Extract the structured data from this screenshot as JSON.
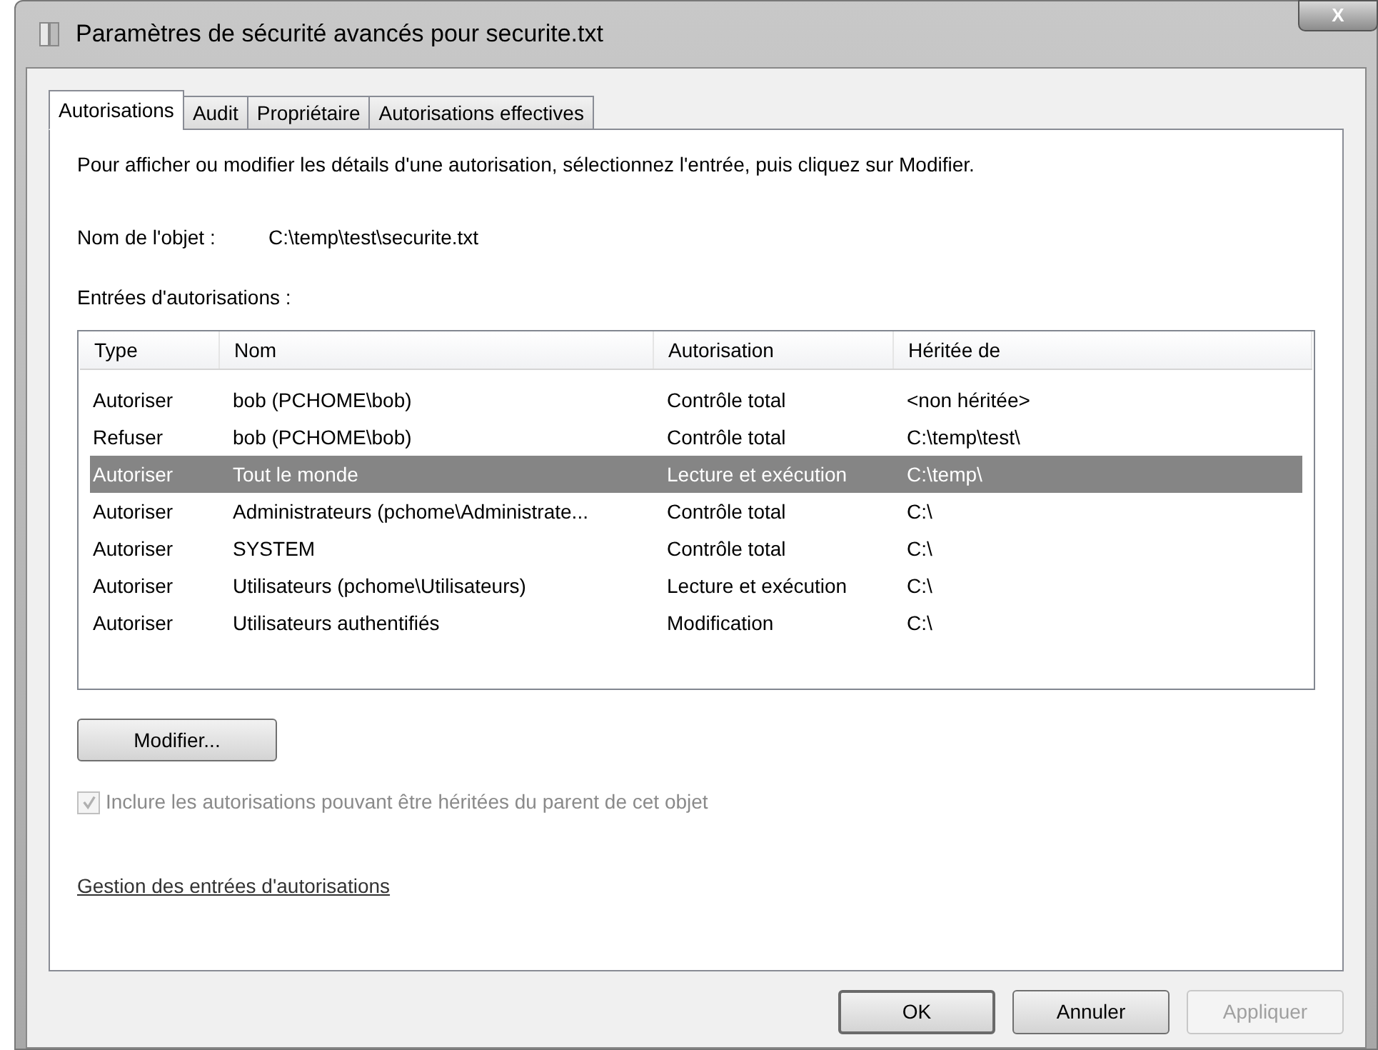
{
  "window": {
    "title": "Paramètres de sécurité avancés pour securite.txt",
    "close": "X"
  },
  "tabs": [
    {
      "label": "Autorisations",
      "selected": true
    },
    {
      "label": "Audit",
      "selected": false
    },
    {
      "label": "Propriétaire",
      "selected": false
    },
    {
      "label": "Autorisations effectives",
      "selected": false
    }
  ],
  "instructions": "Pour afficher ou modifier les détails d'une autorisation, sélectionnez l'entrée, puis cliquez sur Modifier.",
  "object_name": {
    "label": "Nom de l'objet :",
    "value": "C:\\temp\\test\\securite.txt"
  },
  "entries_label": "Entrées d'autorisations :",
  "table": {
    "columns": [
      "Type",
      "Nom",
      "Autorisation",
      "Héritée de"
    ],
    "rows": [
      {
        "cells": [
          "Autoriser",
          "bob (PCHOME\\bob)",
          "Contrôle total",
          "<non héritée>"
        ],
        "selected": false
      },
      {
        "cells": [
          "Refuser",
          "bob (PCHOME\\bob)",
          "Contrôle total",
          "C:\\temp\\test\\"
        ],
        "selected": false
      },
      {
        "cells": [
          "Autoriser",
          "Tout le monde",
          "Lecture et exécution",
          "C:\\temp\\"
        ],
        "selected": true
      },
      {
        "cells": [
          "Autoriser",
          "Administrateurs (pchome\\Administrate...",
          "Contrôle total",
          "C:\\"
        ],
        "selected": false
      },
      {
        "cells": [
          "Autoriser",
          "SYSTEM",
          "Contrôle total",
          "C:\\"
        ],
        "selected": false
      },
      {
        "cells": [
          "Autoriser",
          "Utilisateurs (pchome\\Utilisateurs)",
          "Lecture et exécution",
          "C:\\"
        ],
        "selected": false
      },
      {
        "cells": [
          "Autoriser",
          "Utilisateurs authentifiés",
          "Modification",
          "C:\\"
        ],
        "selected": false
      }
    ]
  },
  "edit_button": "Modifier...",
  "inherit_checkbox": {
    "label": "Inclure les autorisations pouvant être héritées du parent de cet objet",
    "checked": true,
    "disabled": true
  },
  "manage_link": "Gestion des entrées d'autorisations",
  "buttons": [
    {
      "label": "OK",
      "disabled": false,
      "default": true
    },
    {
      "label": "Annuler",
      "disabled": false,
      "default": false
    },
    {
      "label": "Appliquer",
      "disabled": true,
      "default": false
    }
  ]
}
